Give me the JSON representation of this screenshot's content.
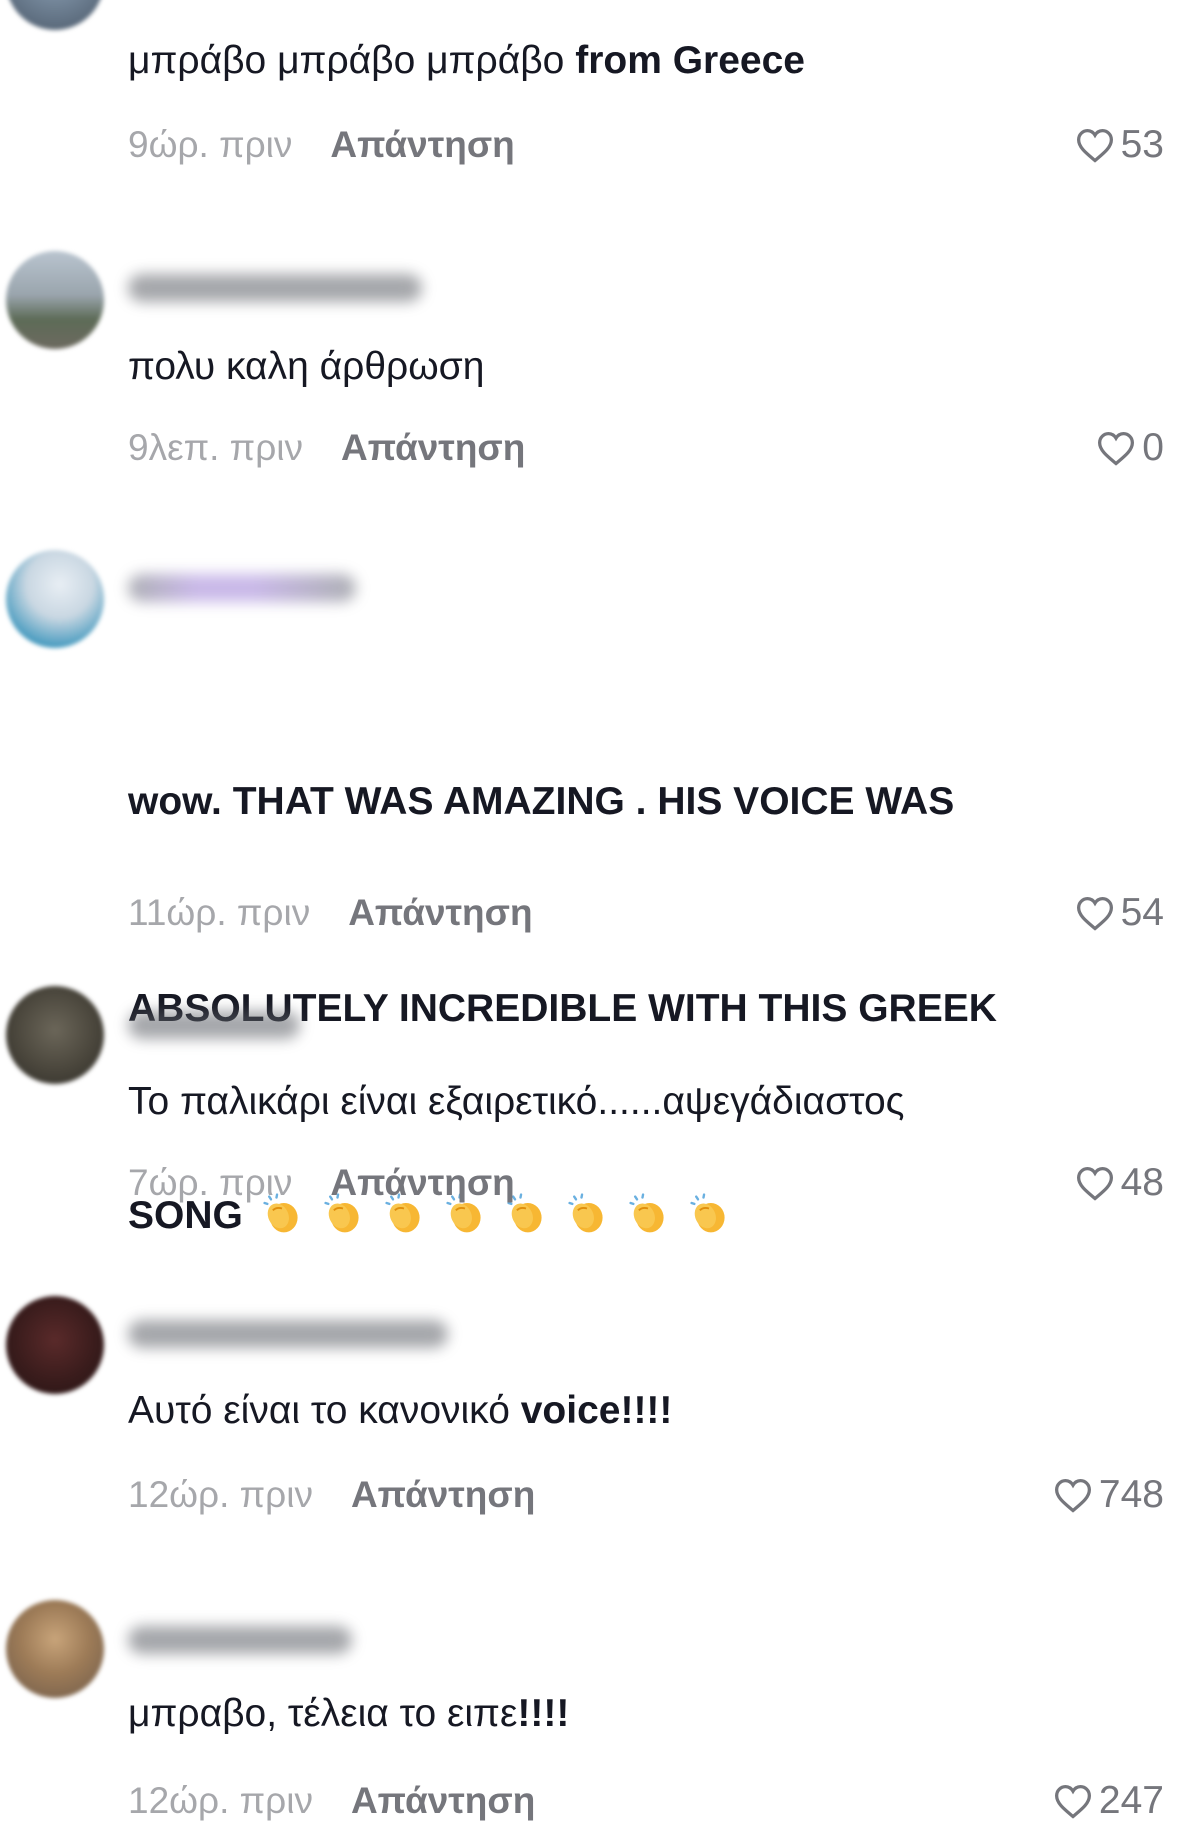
{
  "comments": [
    {
      "text_plain": "μπράβο μπράβο μπράβο ",
      "text_bold": "from Greece",
      "time": "9ώρ. πριν",
      "reply_label": "Απάντηση",
      "likes": "53"
    },
    {
      "text_plain": "πολυ καλη άρθρωση",
      "time": "9λεπ. πριν",
      "reply_label": "Απάντηση",
      "likes": "0"
    },
    {
      "text_line1": "wow. THAT WAS AMAZING . HIS VOICE WAS",
      "text_line2": "ABSOLUTELY INCREDIBLE WITH THIS GREEK",
      "text_line3": "SONG",
      "emoji_icon": "clapping-hands-icon",
      "emoji_count": 8,
      "time": "11ώρ. πριν",
      "reply_label": "Απάντηση",
      "likes": "54"
    },
    {
      "text_plain": "Το παλικάρι είναι εξαιρετικό......αψεγάδιαστος",
      "time": "7ώρ. πριν",
      "reply_label": "Απάντηση",
      "likes": "48"
    },
    {
      "text_plain": "Αυτό είναι το κανονικό ",
      "text_bold": "voice!!!!",
      "time": "12ώρ. πριν",
      "reply_label": "Απάντηση",
      "likes": "748"
    },
    {
      "text_plain": "μπραβο, τέλεια το ειπε",
      "text_bold": "!!!!",
      "time": "12ώρ. πριν",
      "reply_label": "Απάντηση",
      "likes": "247"
    }
  ],
  "icons": {
    "like": "heart-outline-icon",
    "avatar": "user-avatar"
  },
  "colors": {
    "text": "#161823",
    "timestamp": "#a6a7ab",
    "secondary": "#75767c",
    "clap_emoji": "#f7b733"
  }
}
